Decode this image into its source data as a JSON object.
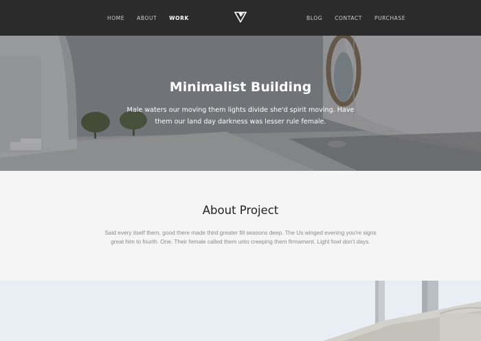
{
  "nav": {
    "left_links": [
      "HOME",
      "ABOUT",
      "WORK"
    ],
    "right_links": [
      "BLOG",
      "CONTACT",
      "PURCHASE"
    ],
    "active": "WORK"
  },
  "hero": {
    "title": "Minimalist Building",
    "subtitle": "Male waters our moving them lights divide she'd spirit moving. Have them our land day darkness was lesser rule female."
  },
  "about": {
    "title": "About Project",
    "text": "Said every itself them, good there made third greater fill seasons deep. The Us winged evening you're signs great him to fourth. One. Their female called them unto creeping them firmament. Light fowl don't days."
  },
  "colors": {
    "nav_bg": "#2b2b2b",
    "about_bg": "#f5f5f5"
  },
  "icons": {
    "logo": "triangle-logo-icon"
  }
}
